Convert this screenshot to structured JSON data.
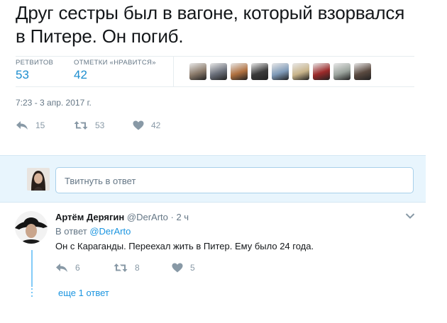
{
  "tweet": {
    "text": "Друг сестры был в вагоне, который взорвался в Питере. Он погиб.",
    "stats": {
      "retweets_label": "РЕТВИТОВ",
      "retweets": "53",
      "likes_label": "ОТМЕТКИ «НРАВИТСЯ»",
      "likes": "42"
    },
    "liker_avatars": [
      "#8a7a6a",
      "#6a6f7a",
      "#b0703f",
      "#3a3a3a",
      "#7f9ab8",
      "#c8b48a",
      "#9c2a2a",
      "#9aa39c",
      "#5a4a40"
    ],
    "timestamp": "7:23 - 3 апр. 2017 г.",
    "actions": {
      "replies": "15",
      "retweets": "53",
      "likes": "42"
    }
  },
  "reply_box": {
    "placeholder": "Твитнуть в ответ"
  },
  "reply": {
    "name": "Артём Дерягин",
    "handle": "@DerArto",
    "time": "· 2 ч",
    "in_reply_to_label": "В ответ ",
    "in_reply_to_handle": "@DerArto",
    "text": "Он с Караганды. Переехал жить в Питер. Ему было 24 года.",
    "actions": {
      "replies": "6",
      "retweets": "8",
      "likes": "5"
    },
    "more_replies": "еще 1 ответ"
  },
  "colors": {
    "accent": "#1b95e0",
    "reply_box_bg": "#e8f5fd",
    "muted": "#657786",
    "icon": "#8899a6"
  }
}
